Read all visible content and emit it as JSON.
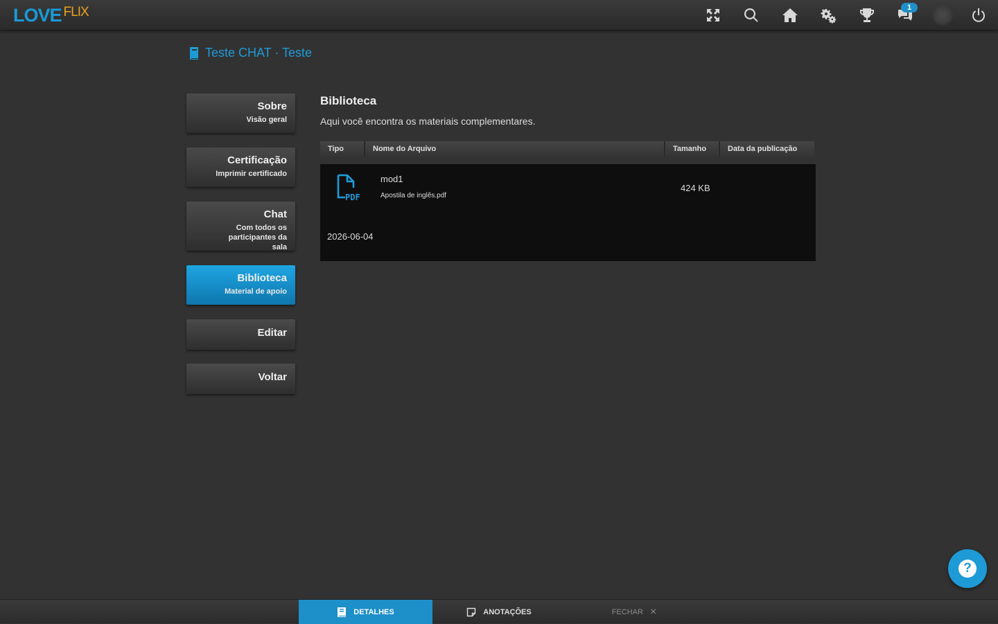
{
  "header": {
    "logo_love": "LOVE",
    "logo_flix": "FLIX",
    "icons": [
      "fullscreen-icon",
      "search-icon",
      "home-icon",
      "gears-icon",
      "trophy-icon",
      "chat-icon",
      "avatar",
      "power-icon"
    ],
    "chat_badge": "1"
  },
  "breadcrumb": {
    "text": "Teste CHAT · Teste"
  },
  "sidebar": {
    "items": [
      {
        "title": "Sobre",
        "subtitle": "Visão geral"
      },
      {
        "title": "Certificação",
        "subtitle": "Imprimir certificado"
      },
      {
        "title": "Chat",
        "subtitle": "Com todos os participantes da sala"
      },
      {
        "title": "Biblioteca",
        "subtitle": "Material de apoio"
      },
      {
        "title": "Editar",
        "subtitle": ""
      },
      {
        "title": "Voltar",
        "subtitle": ""
      }
    ],
    "active_index": 3
  },
  "main": {
    "title": "Biblioteca",
    "description": "Aqui você encontra os materiais complementares.",
    "table": {
      "columns": [
        "Tipo",
        "Nome do Arquivo",
        "Tamanho",
        "Data da publicação"
      ],
      "rows": [
        {
          "type_icon": "pdf-file-icon",
          "name": "mod1",
          "filename": "Apostila de inglês.pdf",
          "size": "424 KB",
          "date": "2026-06-04"
        }
      ]
    }
  },
  "help": {
    "label": "?"
  },
  "bottombar": {
    "tabs": [
      {
        "label": "DETALHES",
        "icon": "book-icon"
      },
      {
        "label": "ANOTAÇÕES",
        "icon": "note-icon"
      }
    ],
    "close_label": "FECHAR",
    "close_icon": "×"
  },
  "colors": {
    "accent": "#1e9bd7",
    "logo_flix": "#e8a21d",
    "background": "#323232"
  }
}
